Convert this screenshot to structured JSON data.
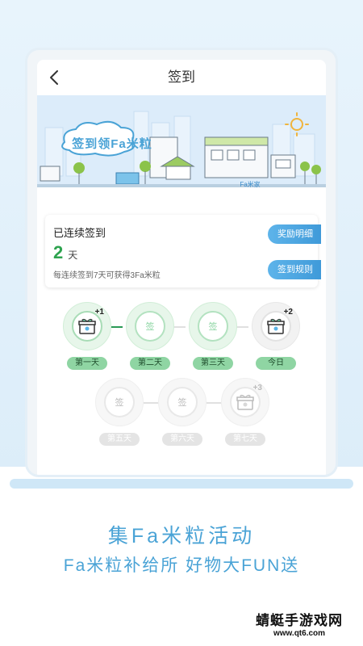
{
  "header": {
    "title": "签到"
  },
  "banner": {
    "headline": "签到领Fa米粒",
    "shop_sign": "Fa米家"
  },
  "summary": {
    "title": "已连续签到",
    "days_count": "2",
    "days_unit": "天",
    "description": "每连续签到7天可获得3Fa米粒",
    "reward_details_button": "奖励明细",
    "checkin_rules_button": "签到规则"
  },
  "days": [
    {
      "label": "第一天",
      "mark": "",
      "bonus": "+1",
      "state": "done",
      "gift": true
    },
    {
      "label": "第二天",
      "mark": "签",
      "bonus": "",
      "state": "done",
      "gift": false
    },
    {
      "label": "第三天",
      "mark": "签",
      "bonus": "",
      "state": "done",
      "gift": false
    },
    {
      "label": "今日",
      "mark": "",
      "bonus": "+2",
      "state": "today",
      "gift": true
    },
    {
      "label": "第五天",
      "mark": "签",
      "bonus": "",
      "state": "future",
      "gift": false
    },
    {
      "label": "第六天",
      "mark": "签",
      "bonus": "",
      "state": "future",
      "gift": false
    },
    {
      "label": "第七天",
      "mark": "",
      "bonus": "+3",
      "state": "future",
      "gift": true
    }
  ],
  "promo": {
    "line1": "集Fa米粒活动",
    "line2": "Fa米粒补给所 好物大FUN送"
  },
  "watermark": {
    "name": "蜻蜓手游戏网",
    "url": "www.qt6.com"
  },
  "colors": {
    "accent": "#4aa3d6",
    "success": "#2ea34f",
    "day_label": "#8fd5a3",
    "pill": "#3f9ad9"
  },
  "icons": {
    "back": "chevron-left-icon",
    "gift": "gift-box-icon",
    "sun": "sun-icon"
  }
}
